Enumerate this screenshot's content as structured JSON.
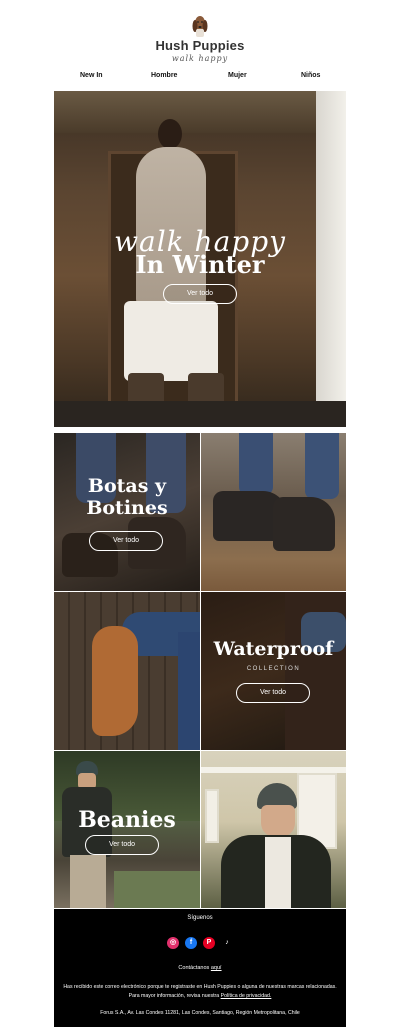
{
  "brand": {
    "name": "Hush Puppies",
    "tagline": "walk happy",
    "logo_icon": "basset-hound-icon"
  },
  "nav": {
    "items": [
      {
        "label": "New In"
      },
      {
        "label": "Hombre"
      },
      {
        "label": "Mujer"
      },
      {
        "label": "Niños"
      }
    ]
  },
  "hero": {
    "script": "walk happy",
    "title": "In Winter",
    "button": "Ver todo"
  },
  "tiles": {
    "botas": {
      "title_line1": "Botas y",
      "title_line2": "Botines",
      "button": "Ver todo"
    },
    "waterproof": {
      "title": "Waterproof",
      "subtitle": "COLLECTION",
      "button": "Ver todo"
    },
    "beanies": {
      "title": "Beanies",
      "button": "Ver todo"
    }
  },
  "footer": {
    "follow_label": "Síguenos",
    "socials": [
      {
        "name": "instagram-icon",
        "glyph": "◎",
        "color": "#e1306c"
      },
      {
        "name": "facebook-icon",
        "glyph": "f",
        "color": "#1877f2"
      },
      {
        "name": "pinterest-icon",
        "glyph": "P",
        "color": "#e60023"
      },
      {
        "name": "tiktok-icon",
        "glyph": "♪",
        "color": "#000000"
      }
    ],
    "contact_text": "Contáctanos",
    "contact_link": "aquí",
    "legal_line1": "Has recibido este correo electrónico porque te registraste en Hush Puppies o alguna de nuestras marcas relacionadas.",
    "legal_line2_text": "Para mayor información, revisa nuestra",
    "privacy_link": "Política de privacidad.",
    "address": "Forus S.A., Av. Las Condes 11281, Las Condes, Santiago, Región Metropolitana, Chile"
  },
  "colors": {
    "footer_bg": "#000000",
    "page_bg": "#ffffff",
    "text_light": "#ffffff"
  }
}
